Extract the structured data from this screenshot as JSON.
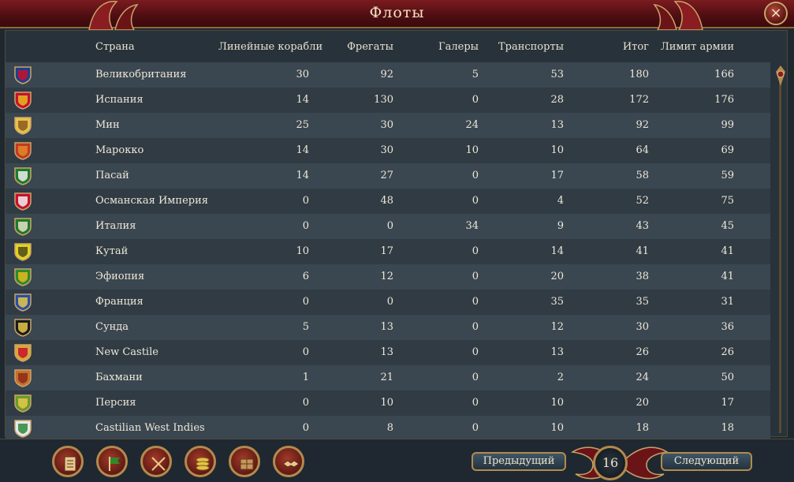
{
  "window": {
    "title": "Флоты",
    "close_symbol": "×"
  },
  "headers": {
    "country": "Страна",
    "ships_of_line": "Линейные корабли",
    "frigates": "Фрегаты",
    "galleys": "Галеры",
    "transports": "Транспорты",
    "total": "Итог",
    "army_limit": "Лимит армии"
  },
  "rows": [
    {
      "country": "Великобритания",
      "ships_of_line": "30",
      "frigates": "92",
      "galleys": "5",
      "transports": "53",
      "total": "180",
      "limit": "166",
      "flag": "union-jack-flag-icon"
    },
    {
      "country": "Испания",
      "ships_of_line": "14",
      "frigates": "130",
      "galleys": "0",
      "transports": "28",
      "total": "172",
      "limit": "176",
      "flag": "spain-flag-icon"
    },
    {
      "country": "Мин",
      "ships_of_line": "25",
      "frigates": "30",
      "galleys": "24",
      "transports": "13",
      "total": "92",
      "limit": "99",
      "flag": "ming-flag-icon"
    },
    {
      "country": "Марокко",
      "ships_of_line": "14",
      "frigates": "30",
      "galleys": "10",
      "transports": "10",
      "total": "64",
      "limit": "69",
      "flag": "morocco-flag-icon"
    },
    {
      "country": "Пасай",
      "ships_of_line": "14",
      "frigates": "27",
      "galleys": "0",
      "transports": "17",
      "total": "58",
      "limit": "59",
      "flag": "pasai-flag-icon"
    },
    {
      "country": "Османская Империя",
      "ships_of_line": "0",
      "frigates": "48",
      "galleys": "0",
      "transports": "4",
      "total": "52",
      "limit": "75",
      "flag": "ottoman-flag-icon"
    },
    {
      "country": "Италия",
      "ships_of_line": "0",
      "frigates": "0",
      "galleys": "34",
      "transports": "9",
      "total": "43",
      "limit": "45",
      "flag": "italy-flag-icon"
    },
    {
      "country": "Кутай",
      "ships_of_line": "10",
      "frigates": "17",
      "galleys": "0",
      "transports": "14",
      "total": "41",
      "limit": "41",
      "flag": "kutai-flag-icon"
    },
    {
      "country": "Эфиопия",
      "ships_of_line": "6",
      "frigates": "12",
      "galleys": "0",
      "transports": "20",
      "total": "38",
      "limit": "41",
      "flag": "ethiopia-flag-icon"
    },
    {
      "country": "Франция",
      "ships_of_line": "0",
      "frigates": "0",
      "galleys": "0",
      "transports": "35",
      "total": "35",
      "limit": "31",
      "flag": "france-flag-icon"
    },
    {
      "country": "Сунда",
      "ships_of_line": "5",
      "frigates": "13",
      "galleys": "0",
      "transports": "12",
      "total": "30",
      "limit": "36",
      "flag": "sunda-flag-icon"
    },
    {
      "country": "New Castile",
      "ships_of_line": "0",
      "frigates": "13",
      "galleys": "0",
      "transports": "13",
      "total": "26",
      "limit": "26",
      "flag": "new-castile-flag-icon"
    },
    {
      "country": "Бахмани",
      "ships_of_line": "1",
      "frigates": "21",
      "galleys": "0",
      "transports": "2",
      "total": "24",
      "limit": "50",
      "flag": "bahmani-flag-icon"
    },
    {
      "country": "Персия",
      "ships_of_line": "0",
      "frigates": "10",
      "galleys": "0",
      "transports": "10",
      "total": "20",
      "limit": "17",
      "flag": "persia-flag-icon"
    },
    {
      "country": "Castilian West Indies",
      "ships_of_line": "0",
      "frigates": "8",
      "galleys": "0",
      "transports": "10",
      "total": "18",
      "limit": "18",
      "flag": "castilian-west-indies-flag-icon"
    }
  ],
  "flag_colors": [
    [
      "#1f3f8a",
      "#c8102e"
    ],
    [
      "#c8102e",
      "#e6b81e"
    ],
    [
      "#e8c34a",
      "#8a5a1e"
    ],
    [
      "#c23a1f",
      "#e08a2a"
    ],
    [
      "#1e7a2a",
      "#f0f0f0"
    ],
    [
      "#c8102e",
      "#f0f0f0"
    ],
    [
      "#1e7a2a",
      "#e8e0c8"
    ],
    [
      "#e6d21e",
      "#4a4a1e"
    ],
    [
      "#2e8a2a",
      "#e6b81e"
    ],
    [
      "#2a4fa0",
      "#e6c84a"
    ],
    [
      "#1a1a1a",
      "#e6c84a"
    ],
    [
      "#d8a83a",
      "#c8102e"
    ],
    [
      "#c8702a",
      "#8a2a1a"
    ],
    [
      "#6a9a2a",
      "#e6c84a"
    ],
    [
      "#e8e8e8",
      "#2a8a3a"
    ]
  ],
  "footer": {
    "bottom_buttons": [
      "ledger-icon",
      "flag-icon",
      "crossed-swords-icon",
      "coins-icon",
      "crate-icon",
      "handshake-icon"
    ],
    "prev_label": "Предыдущий",
    "next_label": "Следующий",
    "page_number": "16"
  }
}
